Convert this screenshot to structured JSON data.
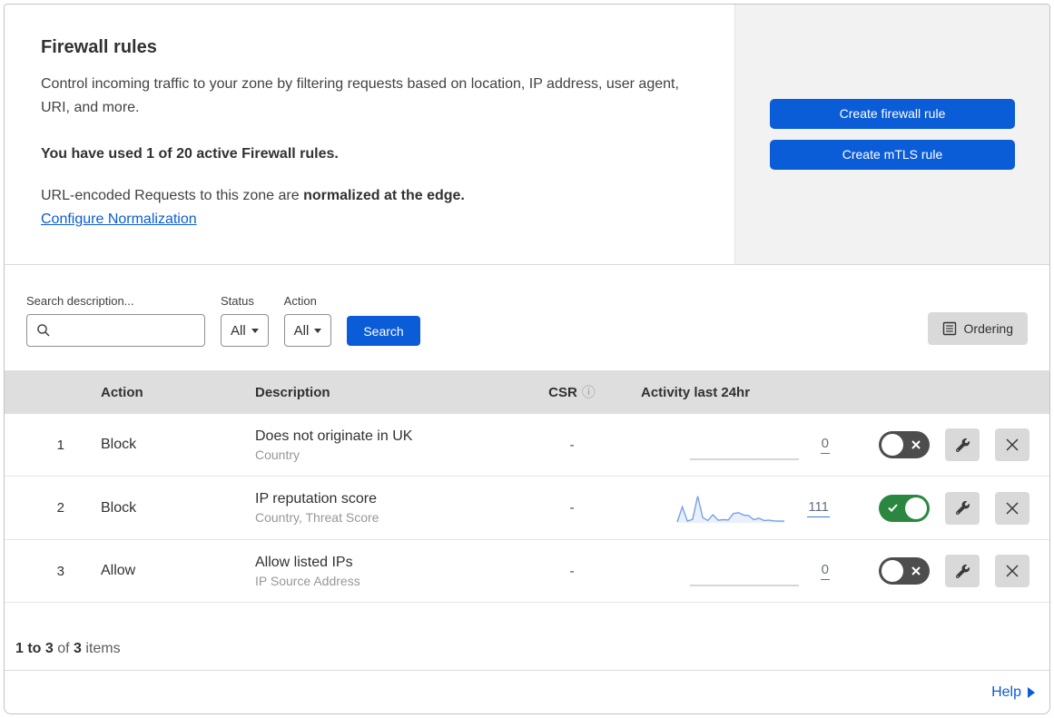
{
  "header": {
    "title": "Firewall rules",
    "description": "Control incoming traffic to your zone by filtering requests based on location, IP address, user agent, URI, and more.",
    "usage": "You have used 1 of 20 active Firewall rules.",
    "normalization_prefix": "URL-encoded Requests to this zone are ",
    "normalization_bold": "normalized at the edge.",
    "normalization_link": "Configure Normalization",
    "create_firewall_button": "Create firewall rule",
    "create_mtls_button": "Create mTLS rule"
  },
  "filters": {
    "search_label": "Search description...",
    "status_label": "Status",
    "status_value": "All",
    "action_label": "Action",
    "action_value": "All",
    "search_button": "Search",
    "ordering_button": "Ordering"
  },
  "table": {
    "columns": {
      "action": "Action",
      "description": "Description",
      "csr": "CSR",
      "info_icon": "ⓘ",
      "activity": "Activity last 24hr"
    },
    "rows": [
      {
        "num": "1",
        "action": "Block",
        "description": "Does not originate in UK",
        "fields": "Country",
        "csr": "-",
        "activity_count": "0",
        "enabled": false,
        "sparkline": []
      },
      {
        "num": "2",
        "action": "Block",
        "description": "IP reputation score",
        "fields": "Country, Threat Score",
        "csr": "-",
        "activity_count": "111",
        "enabled": true,
        "sparkline": [
          3,
          55,
          6,
          12,
          92,
          18,
          8,
          28,
          9,
          11,
          10,
          32,
          35,
          27,
          25,
          11,
          16,
          8,
          9,
          7,
          6,
          6
        ]
      },
      {
        "num": "3",
        "action": "Allow",
        "description": "Allow listed IPs",
        "fields": "IP Source Address",
        "csr": "-",
        "activity_count": "0",
        "enabled": false,
        "sparkline": []
      }
    ]
  },
  "footer": {
    "range": "1 to 3",
    "of": "of",
    "total": "3",
    "items": "items",
    "help": "Help"
  },
  "colors": {
    "primary_blue": "#0b5cd7",
    "toggle_on_green": "#2b873f",
    "toggle_off_gray": "#4d4d4d",
    "sparkline_blue": "#76a1e8",
    "header_gray": "#dedede",
    "panel_gray": "#f2f2f2"
  }
}
